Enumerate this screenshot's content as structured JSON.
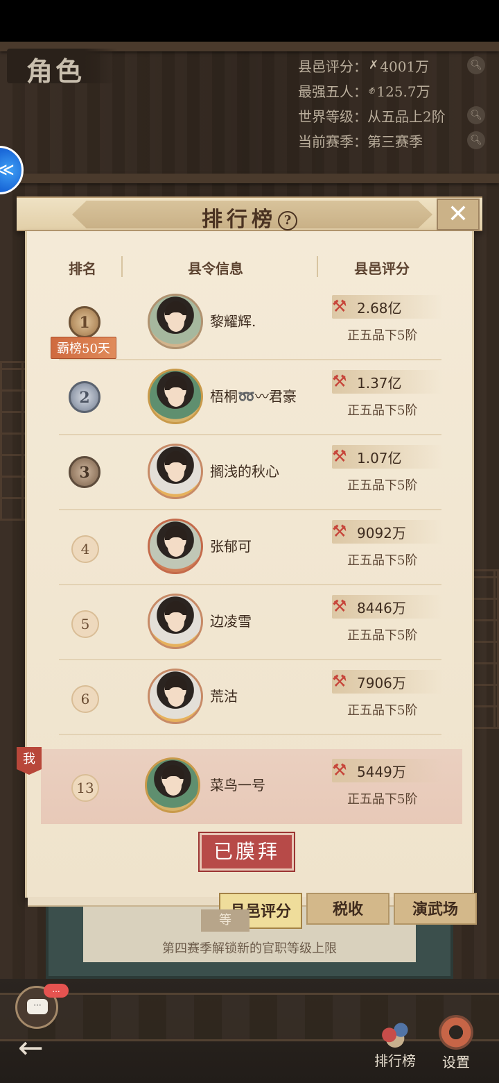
{
  "header": {
    "title": "角色",
    "stats": [
      {
        "label": "县邑评分：",
        "icon": "crossed-tools",
        "value": "4001万",
        "has_help": true
      },
      {
        "label": "最强五人：",
        "icon": "fist",
        "value": "125.7万",
        "has_help": false
      },
      {
        "label": "世界等级：",
        "icon": "",
        "value": "从五品上2阶",
        "has_help": true
      },
      {
        "label": "当前赛季：",
        "icon": "",
        "value": "第三赛季",
        "has_help": true
      }
    ]
  },
  "panel": {
    "title": "排行榜",
    "help_glyph": "?",
    "close_glyph": "✕",
    "columns": [
      "排名",
      "县令信息",
      "县邑评分"
    ]
  },
  "ranking": [
    {
      "rank": "1",
      "medal": "gold",
      "badge": "霸榜50天",
      "name": "黎耀辉.",
      "score": "2.68亿",
      "grade": "正五品下5阶",
      "avatar": "avatar"
    },
    {
      "rank": "2",
      "medal": "silver",
      "badge": "",
      "name": "梧桐➿〰君豪",
      "score": "1.37亿",
      "grade": "正五品下5阶",
      "avatar": "avatar g1"
    },
    {
      "rank": "3",
      "medal": "bronze",
      "badge": "",
      "name": "搁浅的秋心",
      "score": "1.07亿",
      "grade": "正五品下5阶",
      "avatar": "avatar g2"
    },
    {
      "rank": "4",
      "medal": "plain",
      "badge": "",
      "name": "张郁可",
      "score": "9092万",
      "grade": "正五品下5阶",
      "avatar": "avatar g3"
    },
    {
      "rank": "5",
      "medal": "plain",
      "badge": "",
      "name": "边凌雪",
      "score": "8446万",
      "grade": "正五品下5阶",
      "avatar": "avatar g2"
    },
    {
      "rank": "6",
      "medal": "plain",
      "badge": "",
      "name": "荒沽",
      "score": "7906万",
      "grade": "正五品下5阶",
      "avatar": "avatar g2"
    }
  ],
  "me": {
    "tag": "我",
    "rank": "13",
    "name": "菜鸟一号",
    "score": "5449万",
    "grade": "正五品下5阶"
  },
  "worship_button": "已膜拜",
  "tabs": [
    "县邑评分",
    "税收",
    "演武场"
  ],
  "active_tab": "县邑评分",
  "notice": {
    "tag": "等",
    "text": "第四赛季解锁新的官职等级上限"
  },
  "chat": {
    "badge": "...",
    "icon": "chat-bubble"
  },
  "nav": {
    "back_glyph": "←",
    "ranking_label": "排行榜",
    "settings_label": "设置"
  },
  "colors": {
    "accent_red": "#b74a48",
    "parchment": "#f4ead7",
    "score_icon": "#c7463b"
  }
}
